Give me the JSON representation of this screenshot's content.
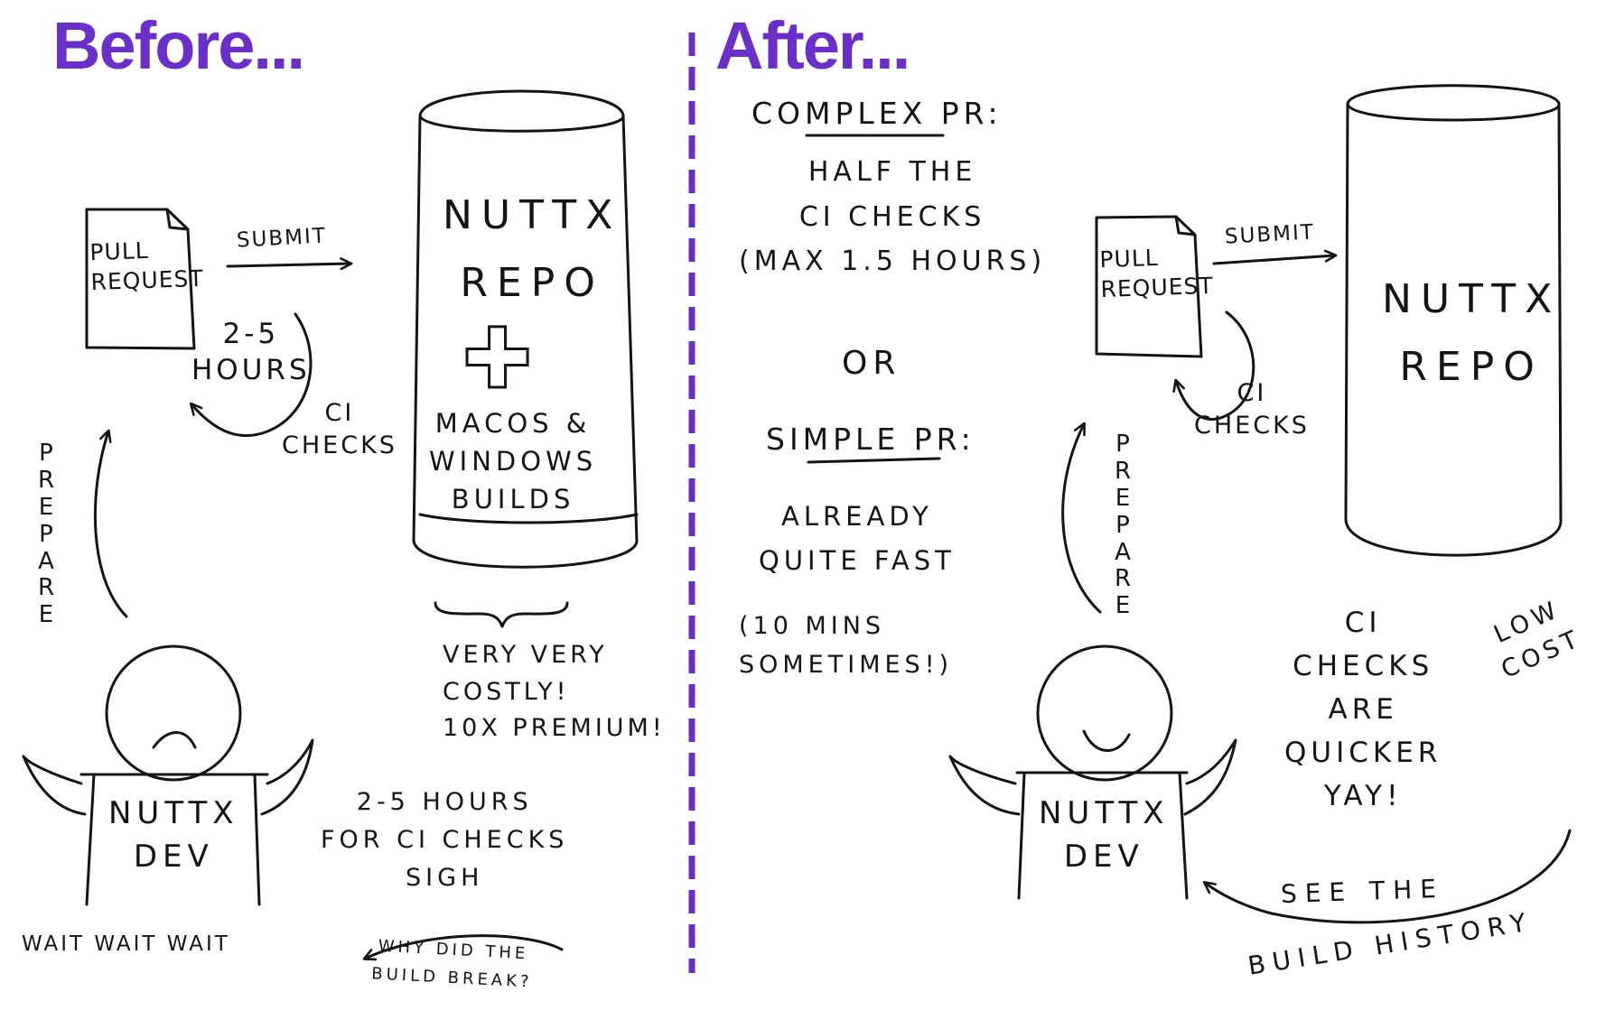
{
  "colors": {
    "heading": "#6a2fc9",
    "ink": "#141414",
    "divider": "#6a2fc9"
  },
  "before": {
    "heading": "Before...",
    "pull_request": "PULL\nREQUEST",
    "submit": "SUBMIT",
    "loop_time": "2-5\nHOURS",
    "ci_checks": "CI\nCHECKS",
    "prepare": "PREPARE",
    "repo_name": "NUTTX\nREPO",
    "plus_glyph": "✚",
    "repo_extra": "MACOS &\nWINDOWS\nBUILDS",
    "cost_note": "VERY VERY\nCOSTLY!\n10x PREMIUM!",
    "dev_label": "NUTTX\nDEV",
    "wait_note": "2-5 HOURS\nFOR CI CHECKS\nSIGH",
    "wait_text": "WAIT WAIT WAIT",
    "why_text": "WHY DID THE\nBUILD BREAK?"
  },
  "after": {
    "heading": "After...",
    "complex_title": "COMPLEX PR:",
    "complex_body": "HALF THE\nCI CHECKS\n(MAX 1.5 HOURS)",
    "or": "OR",
    "simple_title": "SIMPLE PR:",
    "simple_body": "ALREADY\nQUITE FAST",
    "simple_note": "(10 MINS\nSOMETIMES!)",
    "pull_request": "PULL\nREQUEST",
    "submit": "SUBMIT",
    "ci_checks": "CI\nCHECKS",
    "prepare": "PREPARE",
    "repo_name": "NUTTX\nREPO",
    "quick_note": "CI\nCHECKS\nARE\nQUICKER\nYAY!",
    "low_cost": "LOW\nCOST",
    "dev_label": "NUTTX\nDEV",
    "history_line1": "SEE THE",
    "history_line2": "BUILD HISTORY"
  }
}
